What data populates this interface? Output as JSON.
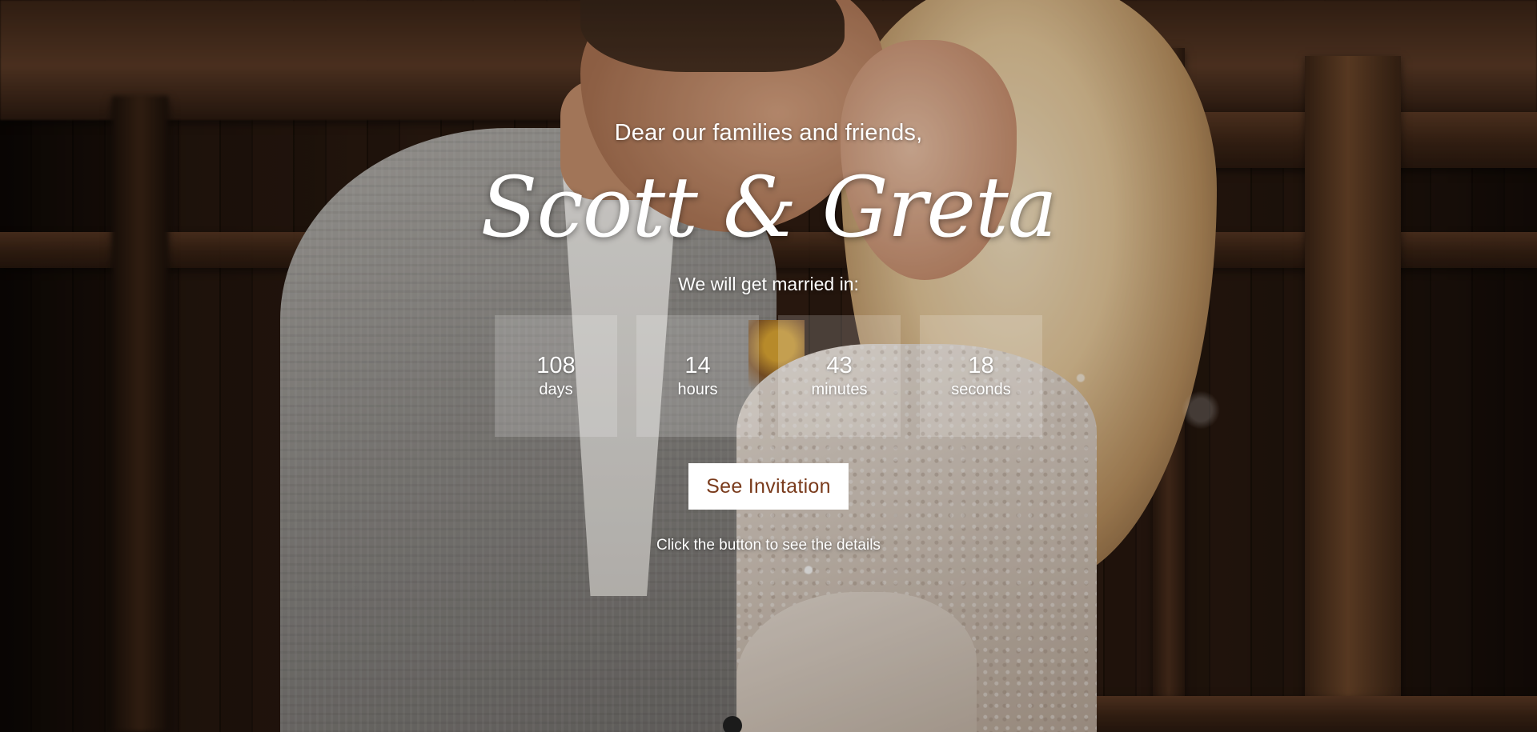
{
  "hero": {
    "greeting": "Dear our families and friends,",
    "names": "Scott & Greta",
    "subtitle": "We will get married in:",
    "countdown": [
      {
        "value": "108",
        "label": "days"
      },
      {
        "value": "14",
        "label": "hours"
      },
      {
        "value": "43",
        "label": "minutes"
      },
      {
        "value": "18",
        "label": "seconds"
      }
    ],
    "button_label": "See Invitation",
    "hint": "Click the button to see the details"
  },
  "colors": {
    "button_bg": "#ffffff",
    "button_text": "#7a3b1c",
    "text": "#ffffff"
  },
  "background": {
    "icon": "couple-photo-background"
  }
}
